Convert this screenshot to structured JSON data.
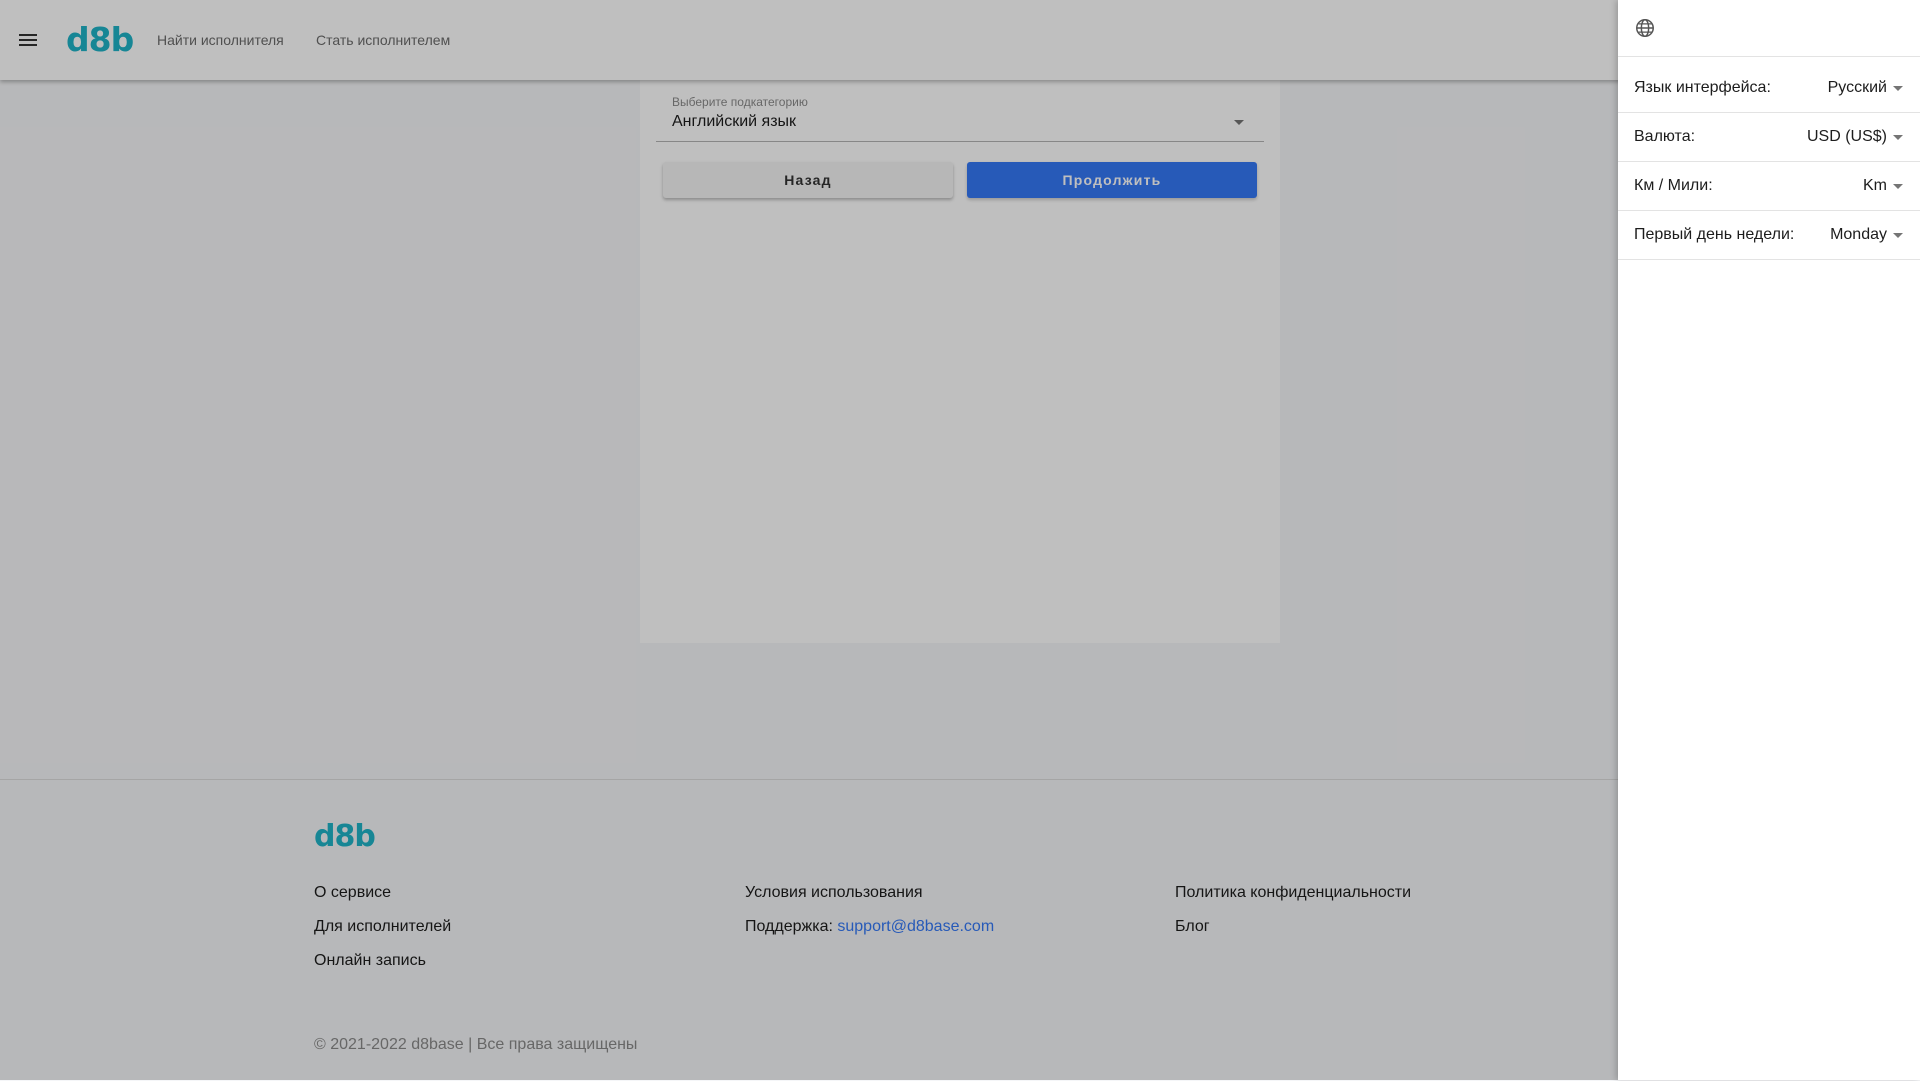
{
  "header": {
    "logo": "d8b",
    "nav": [
      "Найти исполнителя",
      "Стать исполнителем"
    ]
  },
  "form": {
    "subcategory_label": "Выберите подкатегорию",
    "subcategory_value": "Английский язык",
    "back_label": "Назад",
    "continue_label": "Продолжить"
  },
  "footer": {
    "logo": "d8b",
    "col1": [
      "О сервисе",
      "Для исполнителей",
      "Онлайн запись"
    ],
    "col2": {
      "terms": "Условия использования",
      "support_label": "Поддержка:",
      "support_email": "support@d8base.com"
    },
    "col3": [
      "Политика конфиденциальности",
      "Блог"
    ],
    "copyright": "© 2021-2022 d8base | Все права защищены"
  },
  "settings": {
    "icon": "globe-icon",
    "rows": [
      {
        "label": "Язык интерфейса:",
        "value": "Русский"
      },
      {
        "label": "Валюта:",
        "value": "USD (US$)"
      },
      {
        "label": "Км / Мили:",
        "value": "Km"
      },
      {
        "label": "Первый день недели:",
        "value": "Monday"
      }
    ]
  },
  "colors": {
    "brand": "#1fb3c7",
    "primary_button": "#3478f6",
    "link": "#3478f6"
  }
}
